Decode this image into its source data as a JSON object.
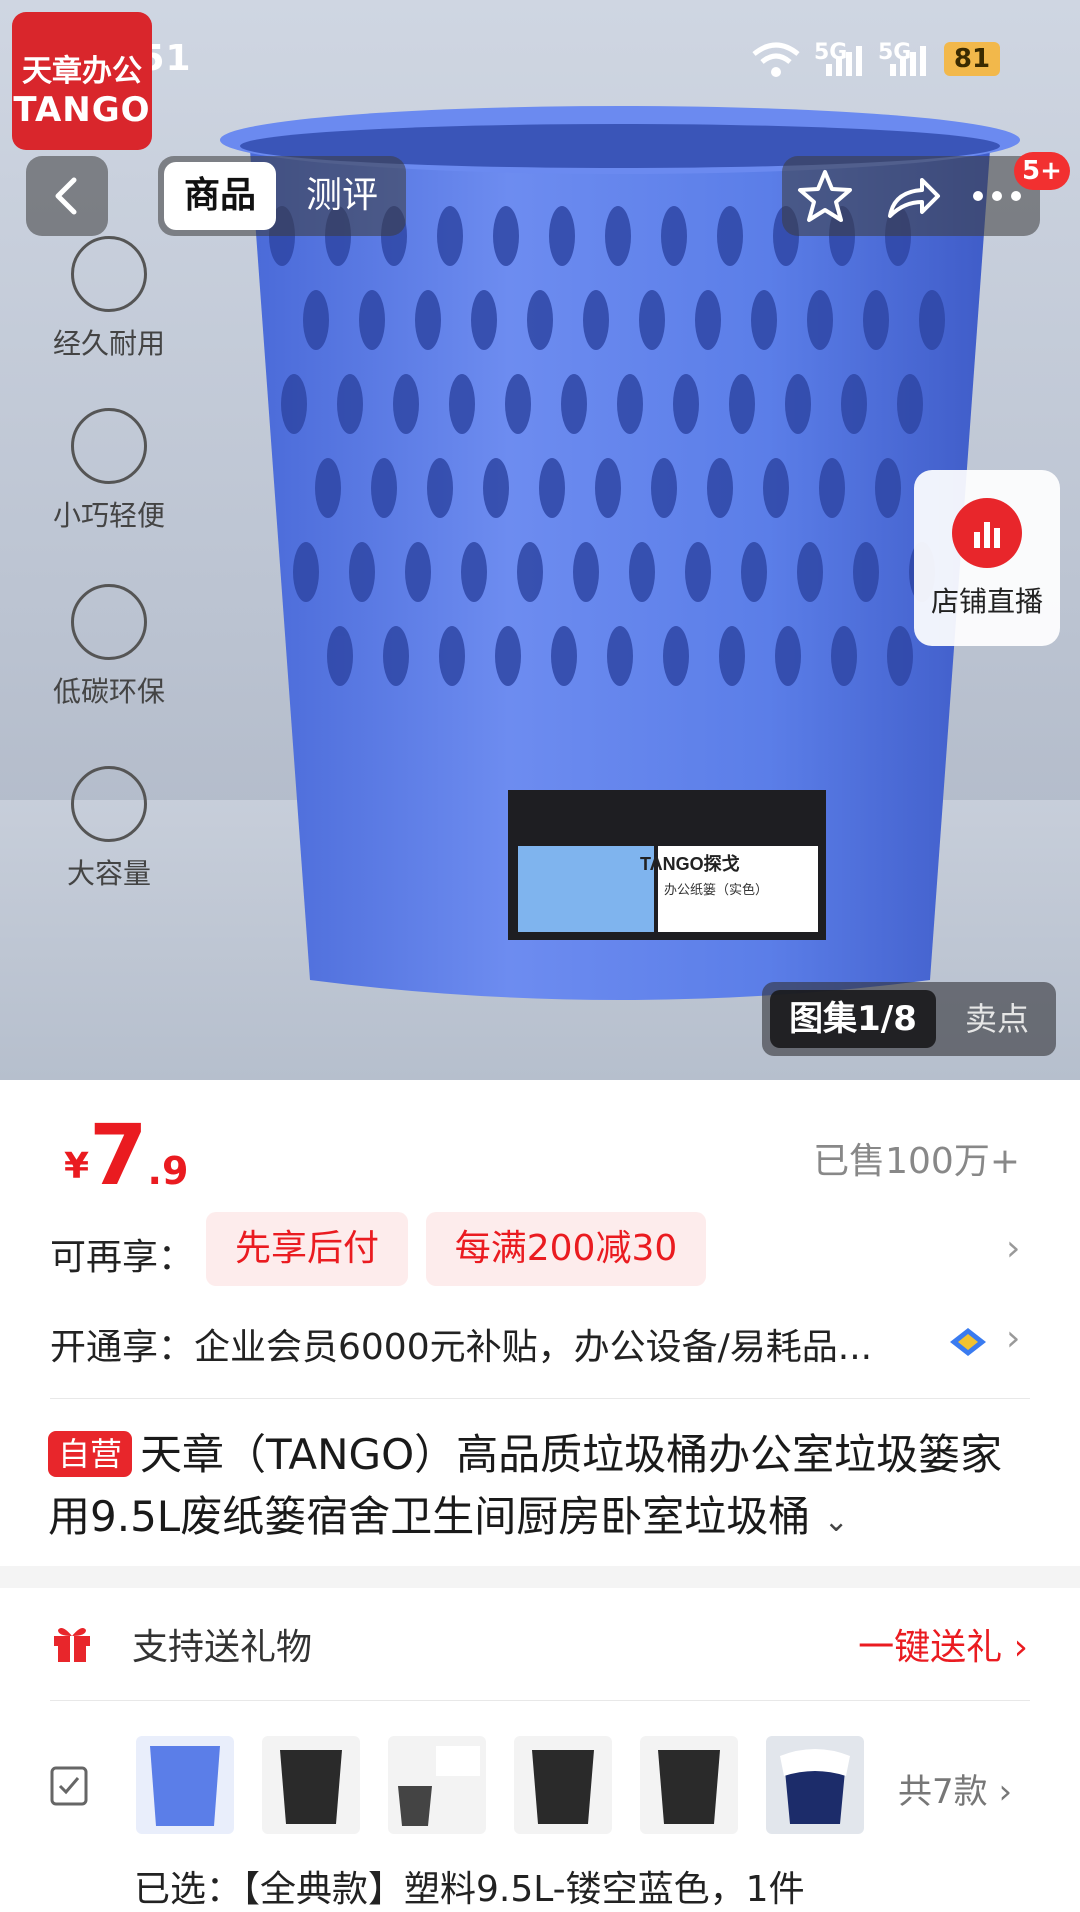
{
  "status_bar": {
    "time": "09:51",
    "sig1": "5G",
    "sig2": "5G",
    "battery": "81"
  },
  "logo": {
    "line1": "天章办公",
    "line2": "TANGO"
  },
  "top_nav": {
    "tab_active": "商品",
    "tab_inactive": "测评",
    "cart_badge": "5+"
  },
  "features": [
    "经久耐用",
    "小巧轻便",
    "低碳环保",
    "大容量"
  ],
  "product_label": {
    "brand": "TANGO探戈",
    "model": "办公纸篓（实色）"
  },
  "live": {
    "label": "店铺直播"
  },
  "gallery": {
    "active": "图集1/8",
    "inactive": "卖点"
  },
  "price": {
    "currency": "¥",
    "integer": "7",
    "decimal": ".9",
    "sold": "已售100万+"
  },
  "promo": {
    "label": "可再享：",
    "tag1": "先享后付",
    "tag2": "每满200减30"
  },
  "membership": {
    "text": "开通享：企业会员6000元补贴，办公设备/易耗品..."
  },
  "title": {
    "tag": "自营",
    "text": "天章（TANGO）高品质垃圾桶办公室垃圾篓家用9.5L废纸篓宿舍卫生间厨房卧室垃圾桶"
  },
  "gift": {
    "label": "支持送礼物",
    "action": "一键送礼"
  },
  "variants": {
    "total": "共7款",
    "selected": "已选：【全典款】塑料9.5L-镂空蓝色，1件"
  },
  "colors": {
    "accent": "#ea1b20",
    "bin_blue": "#5b7ee8"
  }
}
